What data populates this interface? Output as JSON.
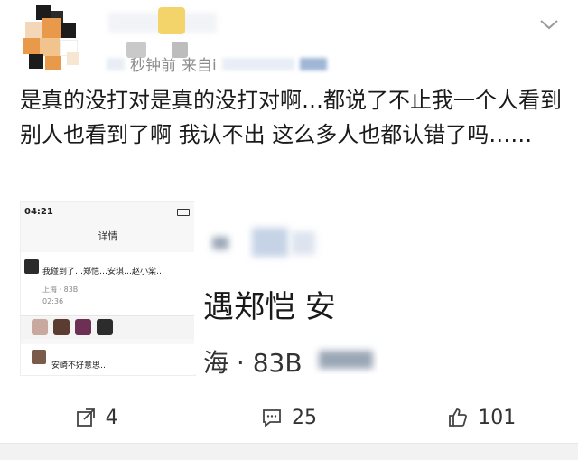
{
  "post": {
    "time_text": "秒钟前",
    "source_text": "来自i",
    "body": "是真的没打对是真的没打对啊…都说了不止我一个人看到 别人也看到了啊 我认不出 这么多人也都认错了吗……"
  },
  "screenshot_left": {
    "status_time": "04:21",
    "title": "详情",
    "comment_text": "我碰到了…郑恺…安琪…赵小棠…",
    "location": "上海 · 83B",
    "comment_time": "02:36",
    "reply_text": "安崎不好意思…"
  },
  "screenshot_right": {
    "line1": "遇郑恺 安",
    "line2": "海 · 83B"
  },
  "actions": {
    "share_count": "4",
    "comment_count": "25",
    "like_count": "101"
  },
  "colors": {
    "puzzle_black": "#1c1c1c",
    "puzzle_orange": "#e89a4a",
    "puzzle_yellow": "#f2d46b",
    "text_main": "#1a1a1a",
    "text_meta": "#8c8c8c"
  }
}
